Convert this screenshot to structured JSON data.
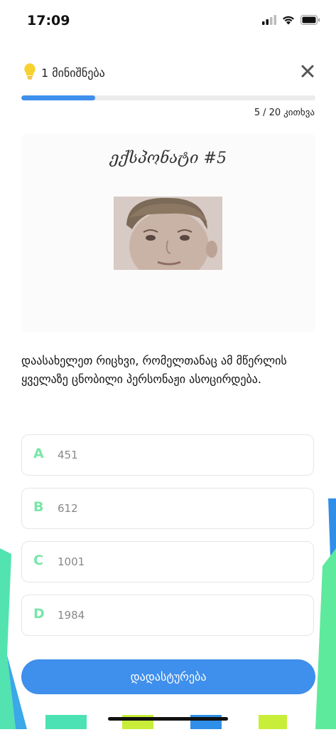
{
  "status": {
    "time": "17:09"
  },
  "hint": {
    "label": "1 მინიშნება"
  },
  "progress": {
    "fraction": 0.25,
    "current": "5",
    "total": "/ 20",
    "unit": "კითხვა"
  },
  "image": {
    "caption": "ექსპონატი #5"
  },
  "question": {
    "text": "დაასახელეთ რიცხვი, რომელთანაც ამ მწერლის ყველაზე ცნობილი პერსონაჟი ასოცირდება."
  },
  "answers": [
    {
      "letter": "A",
      "value": "451"
    },
    {
      "letter": "B",
      "value": "612"
    },
    {
      "letter": "C",
      "value": "1001"
    },
    {
      "letter": "D",
      "value": "1984"
    }
  ],
  "confirm": {
    "label": "დადასტურება"
  },
  "colors": {
    "accent": "#3f8fec",
    "letters": "#79e6a8",
    "hint_bulb": "#f7d22e"
  },
  "icons": [
    "signal-icon",
    "wifi-icon",
    "battery-icon",
    "lightbulb-icon",
    "close-icon"
  ]
}
